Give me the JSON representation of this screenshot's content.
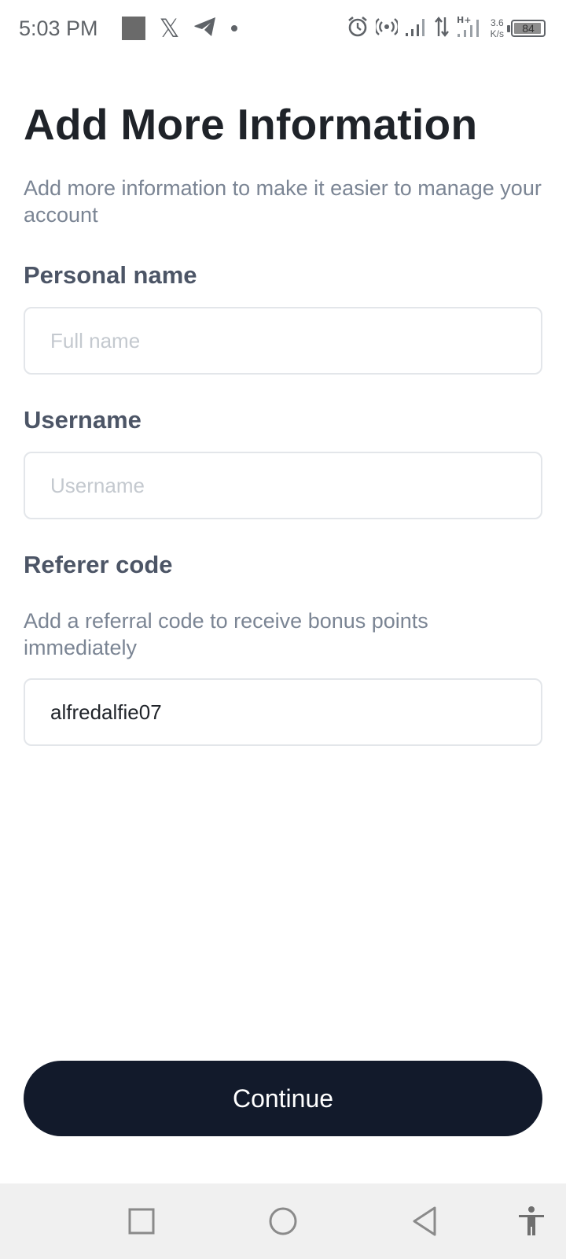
{
  "status_bar": {
    "time": "5:03 PM",
    "net_speed_value": "3.6",
    "net_speed_unit": "K/s",
    "battery": "84",
    "icons": [
      "gallery-icon",
      "x-icon",
      "telegram-icon",
      "dot-icon",
      "alarm-icon",
      "hotspot-icon",
      "signal-icon",
      "data-arrows-icon",
      "h-plus-signal-icon",
      "battery-icon"
    ]
  },
  "page": {
    "title": "Add More Information",
    "subtitle": "Add more information to make it easier to manage your account"
  },
  "form": {
    "personal_name": {
      "label": "Personal name",
      "placeholder": "Full name",
      "value": ""
    },
    "username": {
      "label": "Username",
      "placeholder": "Username",
      "value": ""
    },
    "referer_code": {
      "label": "Referer code",
      "help": "Add a referral code to receive bonus points immediately",
      "value": "alfredalfie07"
    }
  },
  "actions": {
    "continue_label": "Continue"
  },
  "nav_bar": {
    "icons": [
      "recents-square-icon",
      "home-circle-icon",
      "back-triangle-icon",
      "accessibility-icon"
    ]
  },
  "colors": {
    "primary_button": "#121a2b",
    "title": "#1f2329",
    "label": "#4c5566",
    "muted_text": "#7b8594",
    "input_border": "#e3e6ea"
  }
}
